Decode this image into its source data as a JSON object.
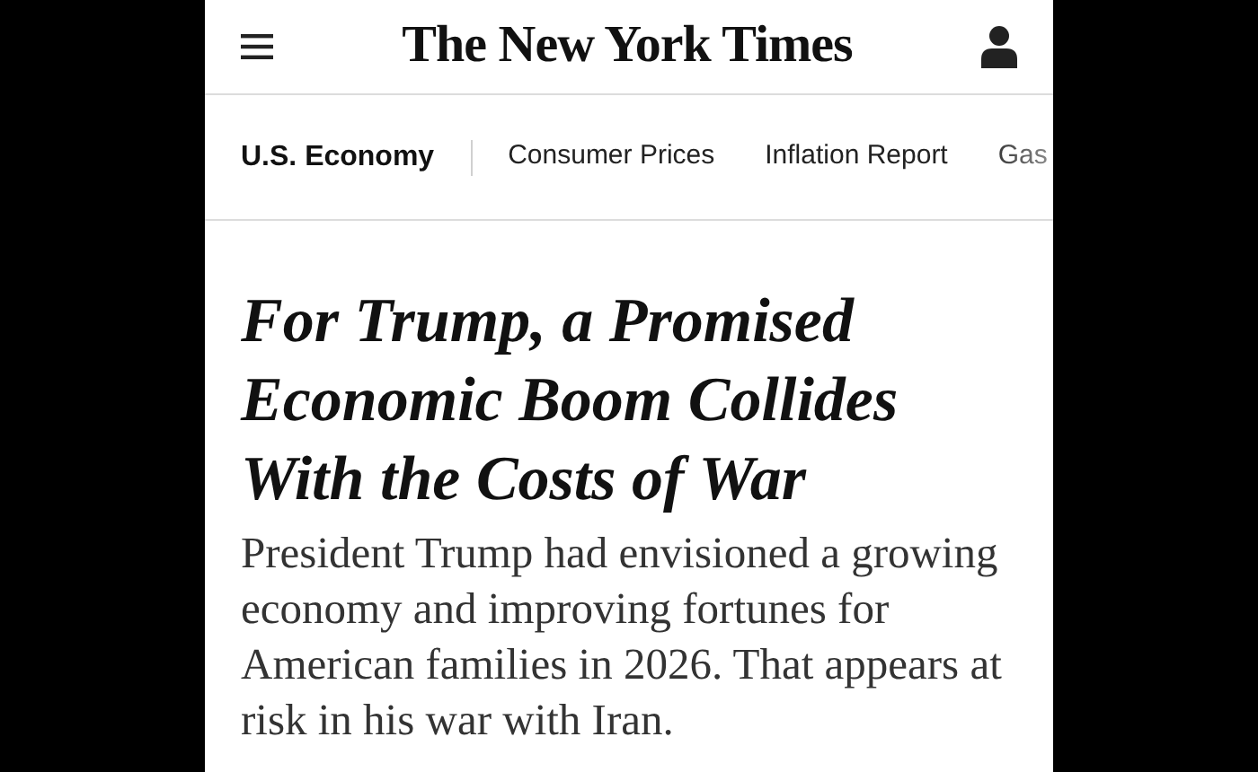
{
  "masthead": {
    "logo": "The New York Times"
  },
  "section_nav": [
    {
      "label": "U.S. Economy",
      "kind": "section"
    },
    {
      "label": "Consumer Prices",
      "kind": "link"
    },
    {
      "label": "Inflation Report",
      "kind": "link"
    },
    {
      "label": "Gas",
      "kind": "link"
    }
  ],
  "article": {
    "headline": "For Trump, a Promised Economic Boom Collides With the Costs of War",
    "summary": "President Trump had envisioned a growing economy and improving fortunes for American families in 2026. That appears at risk in his war with Iran."
  }
}
